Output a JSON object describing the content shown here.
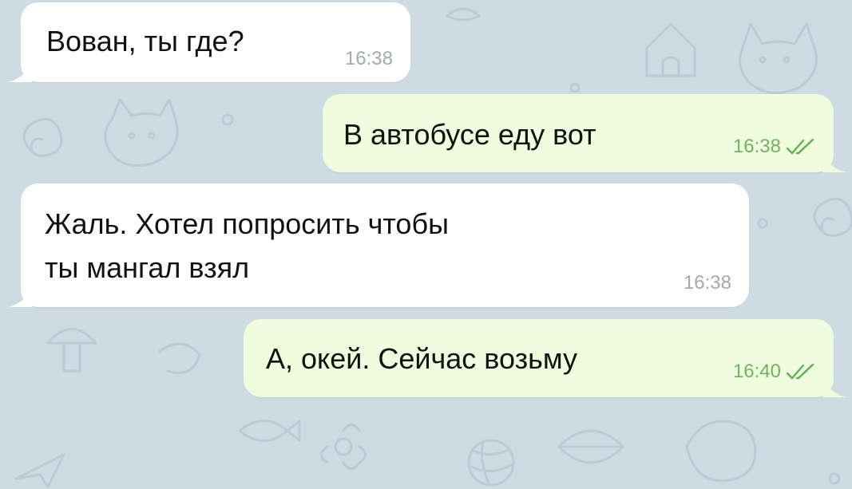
{
  "colors": {
    "wallpaper": "#cfdbe2",
    "incoming_bubble": "#ffffff",
    "outgoing_bubble": "#effdde",
    "incoming_time": "#a3a9ae",
    "outgoing_time": "#6fb460",
    "read_checks": "#5fb052"
  },
  "messages": [
    {
      "direction": "incoming",
      "text": "Вован, ты где?",
      "time": "16:38"
    },
    {
      "direction": "outgoing",
      "text": "В автобусе еду вот",
      "time": "16:38",
      "status_icon": "double-check-icon"
    },
    {
      "direction": "incoming",
      "text_lines": [
        "Жаль. Хотел попросить чтобы",
        "ты мангал взял"
      ],
      "time": "16:38"
    },
    {
      "direction": "outgoing",
      "text": "А, окей. Сейчас возьму",
      "time": "16:40",
      "status_icon": "double-check-icon"
    }
  ]
}
